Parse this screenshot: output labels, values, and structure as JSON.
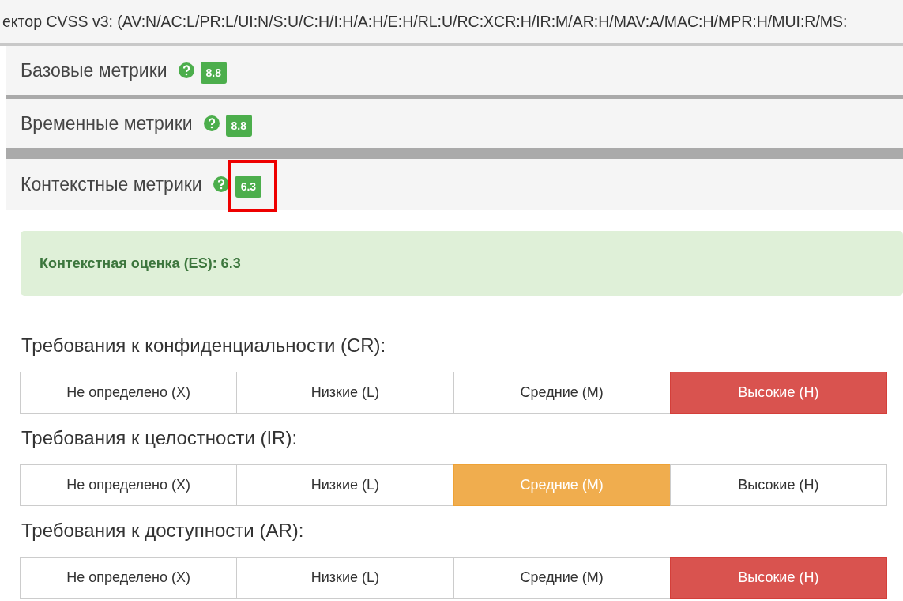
{
  "vector": {
    "text": "ектор CVSS v3: (AV:N/AC:L/PR:L/UI:N/S:U/C:H/I:H/A:H/E:H/RL:U/RC:XCR:H/IR:M/AR:H/MAV:A/MAC:H/MPR:H/MUI:R/MS:"
  },
  "sections": [
    {
      "title": "Базовые метрики",
      "score": "8.8",
      "highlighted": false
    },
    {
      "title": "Временные метрики",
      "score": "8.8",
      "highlighted": false
    },
    {
      "title": "Контекстные метрики",
      "score": "6.3",
      "highlighted": true
    }
  ],
  "alert": {
    "text": "Контекстная оценка (ES): 6.3"
  },
  "groups": [
    {
      "title": "Требования к конфиденциальности (CR):",
      "options": [
        {
          "label": "Не определено (X)",
          "selected": false
        },
        {
          "label": "Низкие (L)",
          "selected": false
        },
        {
          "label": "Средние (M)",
          "selected": false
        },
        {
          "label": "Высокие (H)",
          "kind": "high",
          "selected": true
        }
      ]
    },
    {
      "title": "Требования к целостности (IR):",
      "options": [
        {
          "label": "Не определено (X)",
          "selected": false
        },
        {
          "label": "Низкие (L)",
          "selected": false
        },
        {
          "label": "Средние (M)",
          "kind": "medium",
          "selected": true
        },
        {
          "label": "Высокие (H)",
          "selected": false
        }
      ]
    },
    {
      "title": "Требования к доступности (AR):",
      "options": [
        {
          "label": "Не определено (X)",
          "selected": false
        },
        {
          "label": "Низкие (L)",
          "selected": false
        },
        {
          "label": "Средние (M)",
          "selected": false
        },
        {
          "label": "Высокие (H)",
          "kind": "high",
          "selected": true
        }
      ]
    }
  ]
}
